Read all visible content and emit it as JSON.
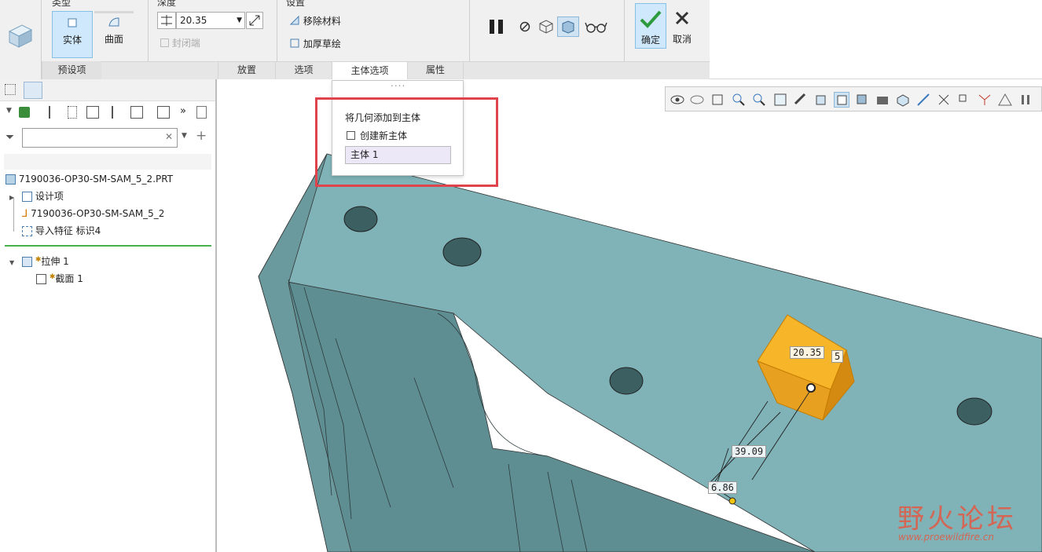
{
  "ribbon": {
    "groups": {
      "type": "类型",
      "depth": "深度",
      "settings": "设置"
    },
    "type_solid": "实体",
    "type_surface": "曲面",
    "depth_value": "20.35",
    "cap_ends": "封闭端",
    "remove_material": "移除材料",
    "thicken_sketch": "加厚草绘",
    "ok": "确定",
    "cancel": "取消",
    "tabs": [
      "预设项",
      "放置",
      "选项",
      "主体选项",
      "属性"
    ]
  },
  "left_panel": {
    "search_placeholder": "",
    "root": "7190036-OP30-SM-SAM_5_2.PRT",
    "items": [
      "设计项",
      "7190036-OP30-SM-SAM_5_2",
      "导入特征 标识4",
      "拉伸 1",
      "截面 1"
    ]
  },
  "popup": {
    "dots": "....",
    "title": "将几何添加到主体",
    "create_new_body": "创建新主体",
    "create_new_body_checked": false,
    "body_value": "主体 1"
  },
  "dimensions": {
    "d1": "20.35",
    "d2": "39.09",
    "d3": "6.86",
    "d4": "5"
  },
  "watermark": {
    "brand": "野火论坛",
    "url": "www.proewildfire.cn"
  },
  "colors": {
    "part": "#7fb3b8",
    "part_dark": "#5f8e92",
    "feature": "#f4a81c",
    "highlight_box": "#e0434b",
    "watermark": "#e8533c"
  }
}
